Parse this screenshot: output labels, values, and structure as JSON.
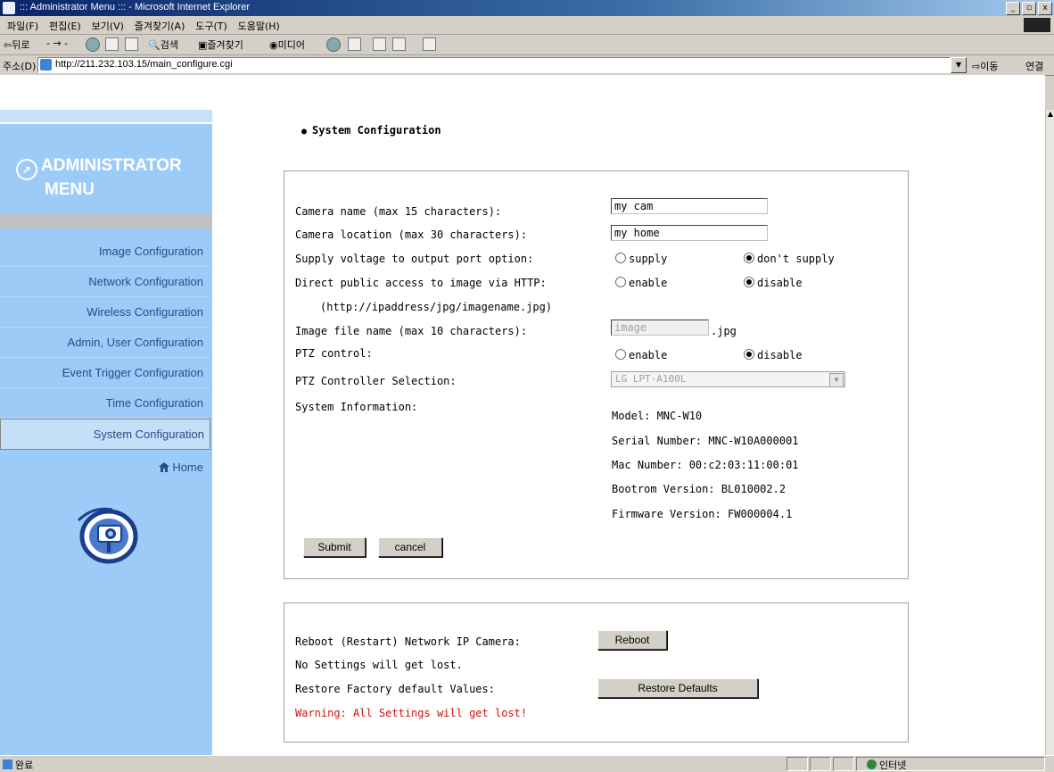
{
  "window": {
    "title": "::: Administrator Menu ::: - Microsoft Internet Explorer",
    "controls": [
      "_",
      "▫",
      "x"
    ]
  },
  "menubar": [
    "파일(F)",
    "편집(E)",
    "보기(V)",
    "즐겨찾기(A)",
    "도구(T)",
    "도움말(H)"
  ],
  "toolbar": {
    "back": "⇦뒤로",
    "search": "검색",
    "favorites": "즐겨찾기",
    "media": "미디어"
  },
  "address": {
    "label": "주소(D)",
    "url": "http://211.232.103.15/main_configure.cgi",
    "go": "이동",
    "links": "연결"
  },
  "sidebar": {
    "title_line1": "ADMINISTRATOR",
    "title_line2": "MENU",
    "items": [
      {
        "label": "Image Configuration"
      },
      {
        "label": "Network Configuration"
      },
      {
        "label": "Wireless Configuration"
      },
      {
        "label": "Admin, User Configuration"
      },
      {
        "label": "Event Trigger Configuration"
      },
      {
        "label": "Time Configuration"
      },
      {
        "label": "System Configuration"
      }
    ],
    "home": "Home"
  },
  "main": {
    "section_title": "System Configuration",
    "fields": {
      "camera_name_label": "Camera name (max 15 characters):",
      "camera_name_value": "my cam",
      "camera_location_label": "Camera location (max 30 characters):",
      "camera_location_value": "my home",
      "supply_label": "Supply voltage to output port option:",
      "supply_opt1": "supply",
      "supply_opt2": "don't supply",
      "http_label": "Direct public access to image via HTTP:",
      "http_label2": "(http://ipaddress/jpg/imagename.jpg)",
      "http_opt1": "enable",
      "http_opt2": "disable",
      "image_file_label": "Image file name (max 10 characters):",
      "image_file_value": "image",
      "image_file_ext": ".jpg",
      "ptz_label": "PTZ control:",
      "ptz_opt1": "enable",
      "ptz_opt2": "disable",
      "ptz_sel_label": "PTZ Controller Selection:",
      "ptz_sel_value": "LG LPT-A100L",
      "sysinfo_label": "System Information:"
    },
    "sysinfo": {
      "model": "Model: MNC-W10",
      "serial": "Serial Number: MNC-W10A000001",
      "mac": "Mac Number: 00:c2:03:11:00:01",
      "bootrom": "Bootrom Version: BL010002.2",
      "firmware": "Firmware Version: FW000004.1"
    },
    "buttons": {
      "submit": "Submit",
      "cancel": "cancel"
    },
    "maintenance": {
      "reboot_label": "Reboot (Restart) Network IP Camera:",
      "reboot_note": "No Settings will get lost.",
      "reboot_button": "Reboot",
      "restore_label": "Restore Factory default Values:",
      "restore_warning": "Warning: All Settings will get lost!",
      "restore_button": "Restore Defaults"
    }
  },
  "statusbar": {
    "status": "완료",
    "zone": "인터넷"
  },
  "colors": {
    "sidebar_bg": "#9dcbf8",
    "nav_text": "#2a4a86",
    "warning": "#d01010"
  }
}
